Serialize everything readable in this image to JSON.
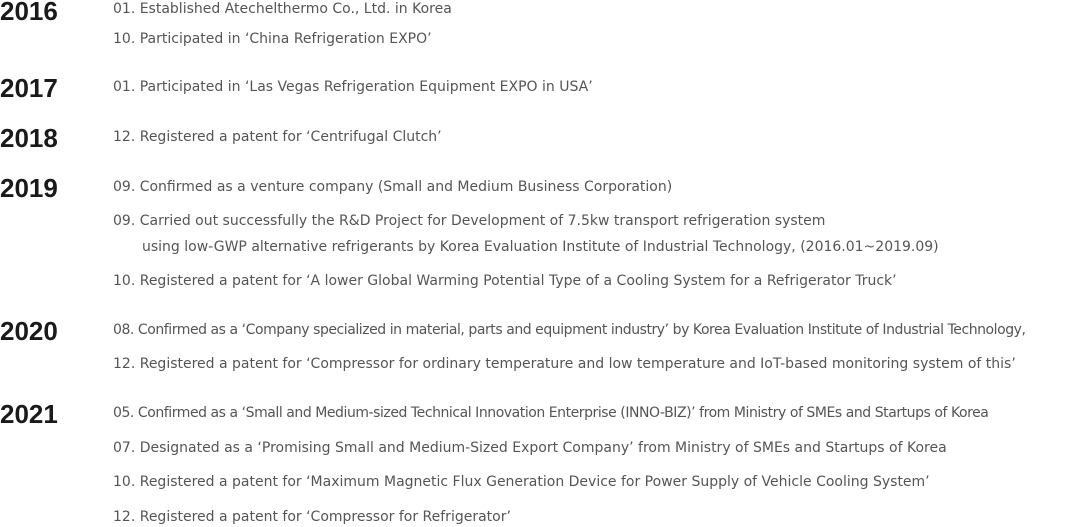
{
  "timeline": [
    {
      "year": "2016",
      "events": [
        "01. Established Atechelthermo Co., Ltd. in Korea",
        "10. Participated in ‘China Refrigeration EXPO’"
      ]
    },
    {
      "year": "2017",
      "events": [
        "01. Participated in ‘Las Vegas Refrigeration Equipment EXPO in USA’"
      ]
    },
    {
      "year": "2018",
      "events": [
        "12. Registered a patent for ‘Centrifugal Clutch’"
      ]
    },
    {
      "year": "2019",
      "events": [
        "09. Confirmed as a venture company (Small and Medium Business Corporation)",
        "09. Carried out successfully the R&D Project for Development of 7.5kw transport refrigeration system",
        "using low-GWP alternative refrigerants by Korea Evaluation Institute of Industrial Technology, (2016.01~2019.09)",
        "10. Registered a patent for ‘A lower Global Warming Potential Type of a Cooling System for a Refrigerator Truck’"
      ]
    },
    {
      "year": "2020",
      "events": [
        "08. Confirmed as a ‘Company specialized in material, parts and equipment industry’ by Korea Evaluation Institute of Industrial Technology,",
        "12. Registered a patent for ‘Compressor for ordinary temperature and low temperature and IoT-based monitoring system of this’"
      ]
    },
    {
      "year": "2021",
      "events": [
        "05. Confirmed as a ‘Small and Medium-sized Technical Innovation Enterprise (INNO-BIZ)’ from Ministry of SMEs and Startups of Korea",
        "07. Designated as a ‘Promising Small and Medium-Sized Export Company’ from Ministry of SMEs and Startups of Korea",
        "10. Registered a patent for ‘Maximum Magnetic Flux Generation Device for Power Supply of Vehicle Cooling System’",
        "12. Registered a patent for ‘Compressor for Refrigerator’"
      ]
    }
  ]
}
